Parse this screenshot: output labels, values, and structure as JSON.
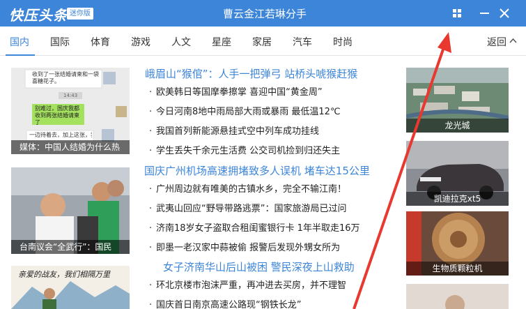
{
  "titlebar": {
    "logo": "快压头条",
    "badge": "迷你版",
    "headline": "曹云金江若琳分手",
    "bg_color": "#3c85d8"
  },
  "window_controls": {
    "menu_icon": "grid-icon",
    "minimize_icon": "minimize-icon",
    "close_icon": "close-icon"
  },
  "tabs": {
    "items": [
      {
        "label": "国内"
      },
      {
        "label": "国际"
      },
      {
        "label": "体育"
      },
      {
        "label": "游戏"
      },
      {
        "label": "人文"
      },
      {
        "label": "星座"
      },
      {
        "label": "家居"
      },
      {
        "label": "汽车"
      },
      {
        "label": "时尚"
      }
    ],
    "active": "国内",
    "back_label": "返回"
  },
  "left_thumbs": {
    "items": [
      {
        "caption": "媒体：中国人结婚为什么热",
        "chat": [
          "收到了一张结婚请柬和一袋喜糖花子。",
          "14:43",
          "别难过，国庆我都收到两张结婚请柬了",
          "一边待着去，加上这张，我就"
        ]
      },
      {
        "caption": "台南议会“全武行”：国民"
      },
      {
        "caption": "",
        "art_text": "亲爱的战友，我们相隔万里"
      }
    ]
  },
  "news": {
    "rows": [
      {
        "type": "headline",
        "text": "峨眉山“猴倌”：人手一把弹弓 站桥头唬猴赶猴"
      },
      {
        "type": "item",
        "text": "欧美韩日等国摩拳擦掌 喜迎中国“黄金周”"
      },
      {
        "type": "item",
        "text": "今日河南8地中雨局部大雨或暴雨 最低温12℃"
      },
      {
        "type": "item",
        "text": "我国首列新能源悬挂式空中列车成功挂线"
      },
      {
        "type": "item",
        "text": "学生丢失千余元生活费 公交司机捡到归还失主"
      },
      {
        "type": "headline",
        "text": "国庆广州机场高速拥堵致多人误机 堵车达15公里"
      },
      {
        "type": "item",
        "text": "广州周边就有唯美的古镇水乡，完全不输江南！"
      },
      {
        "type": "item",
        "text": "武夷山回应“野导带路逃票”：国家旅游局已过问"
      },
      {
        "type": "item",
        "text": "济南18岁女子盗取合租闺蜜银行卡 1年半取走16万"
      },
      {
        "type": "item",
        "text": "即墨一老汉家中蒜被偷 报警后发现外甥女所为"
      },
      {
        "type": "headline",
        "text": "女子济南华山后山被困 警民深夜上山救助"
      },
      {
        "type": "item",
        "text": "环北京楼市泡沫严重，再冲进去买房，并不理智"
      },
      {
        "type": "item",
        "text": "国庆首日南京高速公路现“钢铁长龙”"
      }
    ]
  },
  "right_thumbs": {
    "items": [
      {
        "caption": "龙光城"
      },
      {
        "caption": "凯迪拉克xt5"
      },
      {
        "caption": "生物质颗粒机"
      },
      {
        "caption": ""
      }
    ]
  },
  "annotation": {
    "arrow_color": "#e8382f"
  }
}
